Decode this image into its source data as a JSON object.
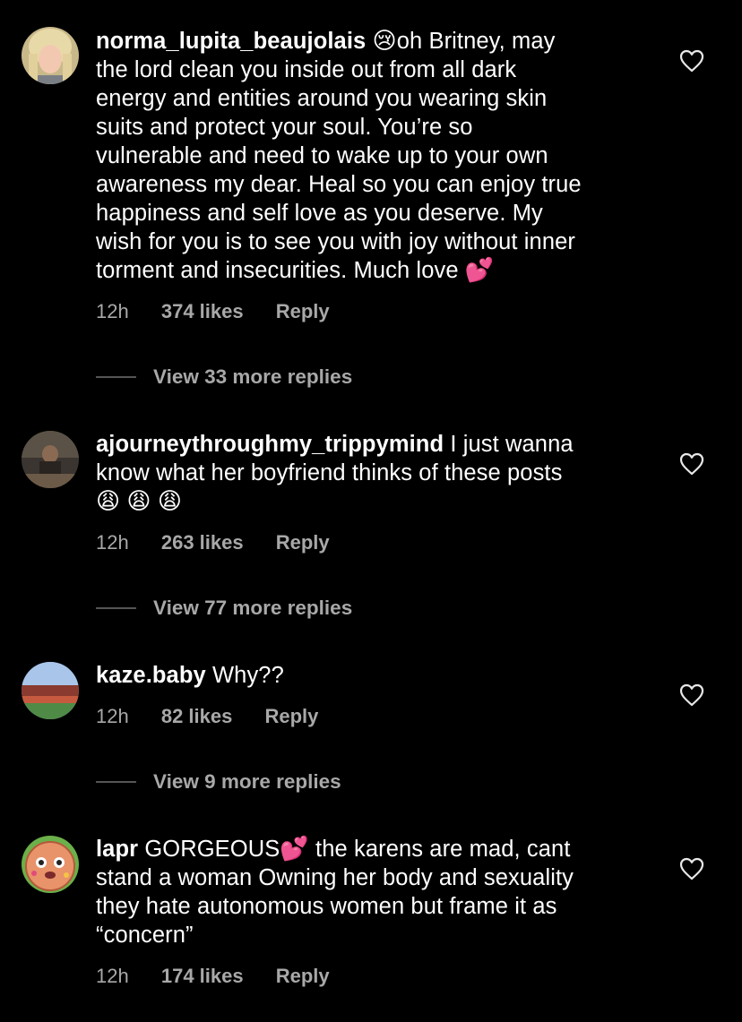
{
  "comments": [
    {
      "username": "norma_lupita_beaujolais",
      "emoji_lead": "😢",
      "lines": [
        "oh Britney, may",
        "the lord clean you inside out from all dark",
        "energy and entities around you wearing skin",
        "suits and protect your soul. You’re so",
        "vulnerable and need to wake up to your own",
        "awareness my dear. Heal so you can enjoy true",
        "happiness and self love as you deserve. My",
        "wish for you is to see you with joy without inner",
        "torment and insecurities. Much love"
      ],
      "emoji_trail": "💕",
      "time": "12h",
      "likes": "374 likes",
      "reply": "Reply",
      "view_replies": "View 33 more replies"
    },
    {
      "username": "ajourneythroughmy_trippymind",
      "first_line": "I just wanna",
      "lines": [
        "know what her boyfriend thinks of these posts"
      ],
      "emojis": [
        "😩",
        "😩",
        "😩"
      ],
      "time": "12h",
      "likes": "263 likes",
      "reply": "Reply",
      "view_replies": "View 77 more replies"
    },
    {
      "username": "kaze.baby",
      "first_line": "Why??",
      "time": "12h",
      "likes": "82 likes",
      "reply": "Reply",
      "view_replies": "View 9 more replies"
    },
    {
      "username": "lapr",
      "first_line_a": "GORGEOUS",
      "first_line_emoji": "💕",
      "first_line_b": "the karens are mad, cant",
      "lines": [
        "stand a woman Owning her body and sexuality",
        "they hate autonomous women but frame it as",
        "“concern”"
      ],
      "time": "12h",
      "likes": "174 likes",
      "reply": "Reply"
    }
  ],
  "icons": {
    "like": "heart-outline-icon"
  }
}
